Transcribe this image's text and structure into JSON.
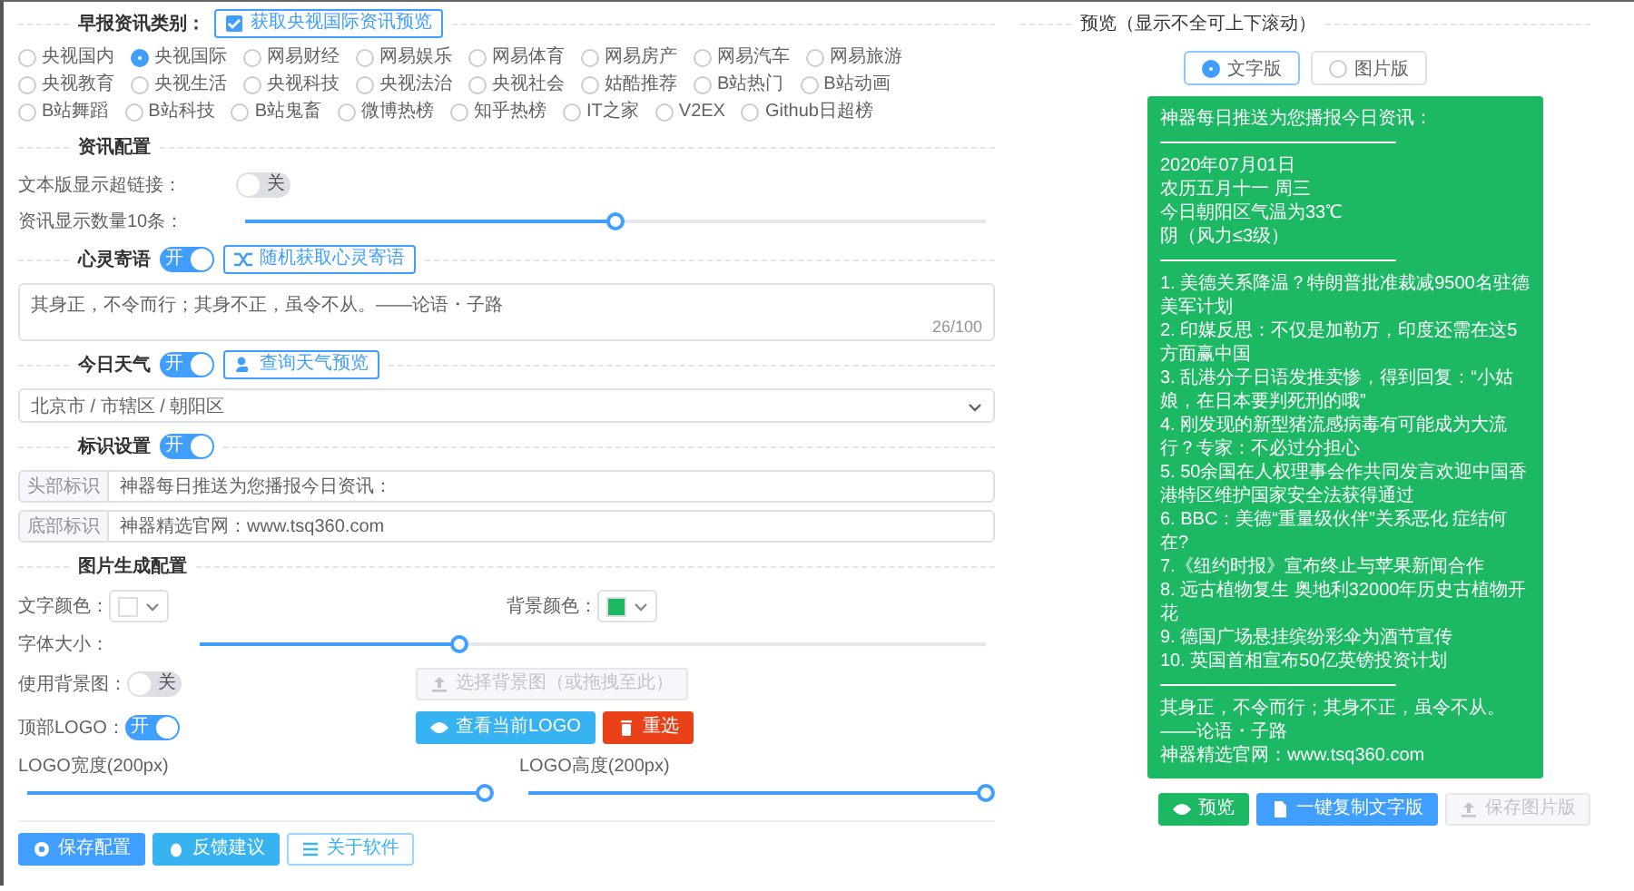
{
  "category": {
    "label": "早报资讯类别：",
    "preview_button": "获取央视国际资讯预览",
    "options": [
      {
        "label": "央视国内",
        "selected": false
      },
      {
        "label": "央视国际",
        "selected": true
      },
      {
        "label": "网易财经",
        "selected": false
      },
      {
        "label": "网易娱乐",
        "selected": false
      },
      {
        "label": "网易体育",
        "selected": false
      },
      {
        "label": "网易房产",
        "selected": false
      },
      {
        "label": "网易汽车",
        "selected": false
      },
      {
        "label": "网易旅游",
        "selected": false
      },
      {
        "label": "央视教育",
        "selected": false
      },
      {
        "label": "央视生活",
        "selected": false
      },
      {
        "label": "央视科技",
        "selected": false
      },
      {
        "label": "央视法治",
        "selected": false
      },
      {
        "label": "央视社会",
        "selected": false
      },
      {
        "label": "姑酷推荐",
        "selected": false
      },
      {
        "label": "B站热门",
        "selected": false
      },
      {
        "label": "B站动画",
        "selected": false
      },
      {
        "label": "B站舞蹈",
        "selected": false
      },
      {
        "label": "B站科技",
        "selected": false
      },
      {
        "label": "B站鬼畜",
        "selected": false
      },
      {
        "label": "微博热榜",
        "selected": false
      },
      {
        "label": "知乎热榜",
        "selected": false
      },
      {
        "label": "IT之家",
        "selected": false
      },
      {
        "label": "V2EX",
        "selected": false
      },
      {
        "label": "Github日超榜",
        "selected": false
      }
    ]
  },
  "news_config": {
    "title": "资讯配置",
    "show_links": {
      "label": "文本版显示超链接：",
      "on": false,
      "state_text": "关"
    },
    "count": {
      "label": "资讯显示数量10条：",
      "level": 0.5
    }
  },
  "quote": {
    "title": "心灵寄语",
    "on": true,
    "state_text": "开",
    "button": "随机获取心灵寄语",
    "value": "其身正，不令而行；其身不正，虽令不从。——论语・子路",
    "counter": "26/100"
  },
  "weather": {
    "title": "今日天气",
    "on": true,
    "state_text": "开",
    "button": "查询天气预览",
    "location": "北京市 / 市辖区 / 朝阳区"
  },
  "marks": {
    "title": "标识设置",
    "on": true,
    "state_text": "开",
    "fields": [
      {
        "label": "头部标识",
        "value": "神器每日推送为您播报今日资讯："
      },
      {
        "label": "底部标识",
        "value": "神器精选官网：www.tsq360.com"
      }
    ]
  },
  "image_config": {
    "title": "图片生成配置",
    "text_color": {
      "label": "文字颜色：",
      "color": "#ffffff"
    },
    "bg_color": {
      "label": "背景颜色：",
      "color": "#1db863"
    },
    "font_size": {
      "label": "字体大小：",
      "level": 0.33
    },
    "bg_image": {
      "label": "使用背景图：",
      "on": false,
      "state_text": "关",
      "button": "选择背景图（或拖拽至此）",
      "disabled": true
    },
    "logo": {
      "label": "顶部LOGO：",
      "on": true,
      "state_text": "开",
      "view_button": "查看当前LOGO",
      "reset_button": "重选"
    },
    "logo_width": {
      "label": "LOGO宽度(200px)",
      "level": 1
    },
    "logo_height": {
      "label": "LOGO高度(200px)",
      "level": 1
    }
  },
  "footer_buttons": [
    {
      "label": "保存配置",
      "kind": "primary"
    },
    {
      "label": "反馈建议",
      "kind": "info"
    },
    {
      "label": "关于软件",
      "kind": "plain"
    }
  ],
  "preview": {
    "title": "预览（显示不全可上下滚动）",
    "modes": [
      {
        "label": "文字版",
        "selected": true
      },
      {
        "label": "图片版",
        "selected": false
      }
    ],
    "header": "神器每日推送为您播报今日资讯：",
    "date_lines": [
      "2020年07月01日",
      "农历五月十一 周三",
      "今日朝阳区气温为33℃",
      "阴（风力≤3级）"
    ],
    "news": [
      "1. 美德关系降温？特朗普批准裁减9500名驻德美军计划",
      "2. 印媒反思：不仅是加勒万，印度还需在这5方面赢中国",
      "3. 乱港分子日语发推卖惨，得到回复：“小姑娘，在日本要判死刑的哦”",
      "4. 刚发现的新型猪流感病毒有可能成为大流行？专家：不必过分担心",
      "5. 50余国在人权理事会作共同发言欢迎中国香港特区维护国家安全法获得通过",
      "6. BBC：美德“重量级伙伴”关系恶化 症结何在?",
      "7.《纽约时报》宣布终止与苹果新闻合作",
      "8. 远古植物复生 奥地利32000年历史古植物开花",
      "9. 德国广场悬挂缤纷彩伞为酒节宣传",
      "10. 英国首相宣布50亿英镑投资计划"
    ],
    "footer_lines": [
      "其身正，不令而行；其身不正，虽令不从。——论语・子路",
      "神器精选官网：www.tsq360.com"
    ],
    "buttons": [
      {
        "label": "预览",
        "kind": "success"
      },
      {
        "label": "一键复制文字版",
        "kind": "primary"
      },
      {
        "label": "保存图片版",
        "kind": "disabled"
      }
    ]
  }
}
